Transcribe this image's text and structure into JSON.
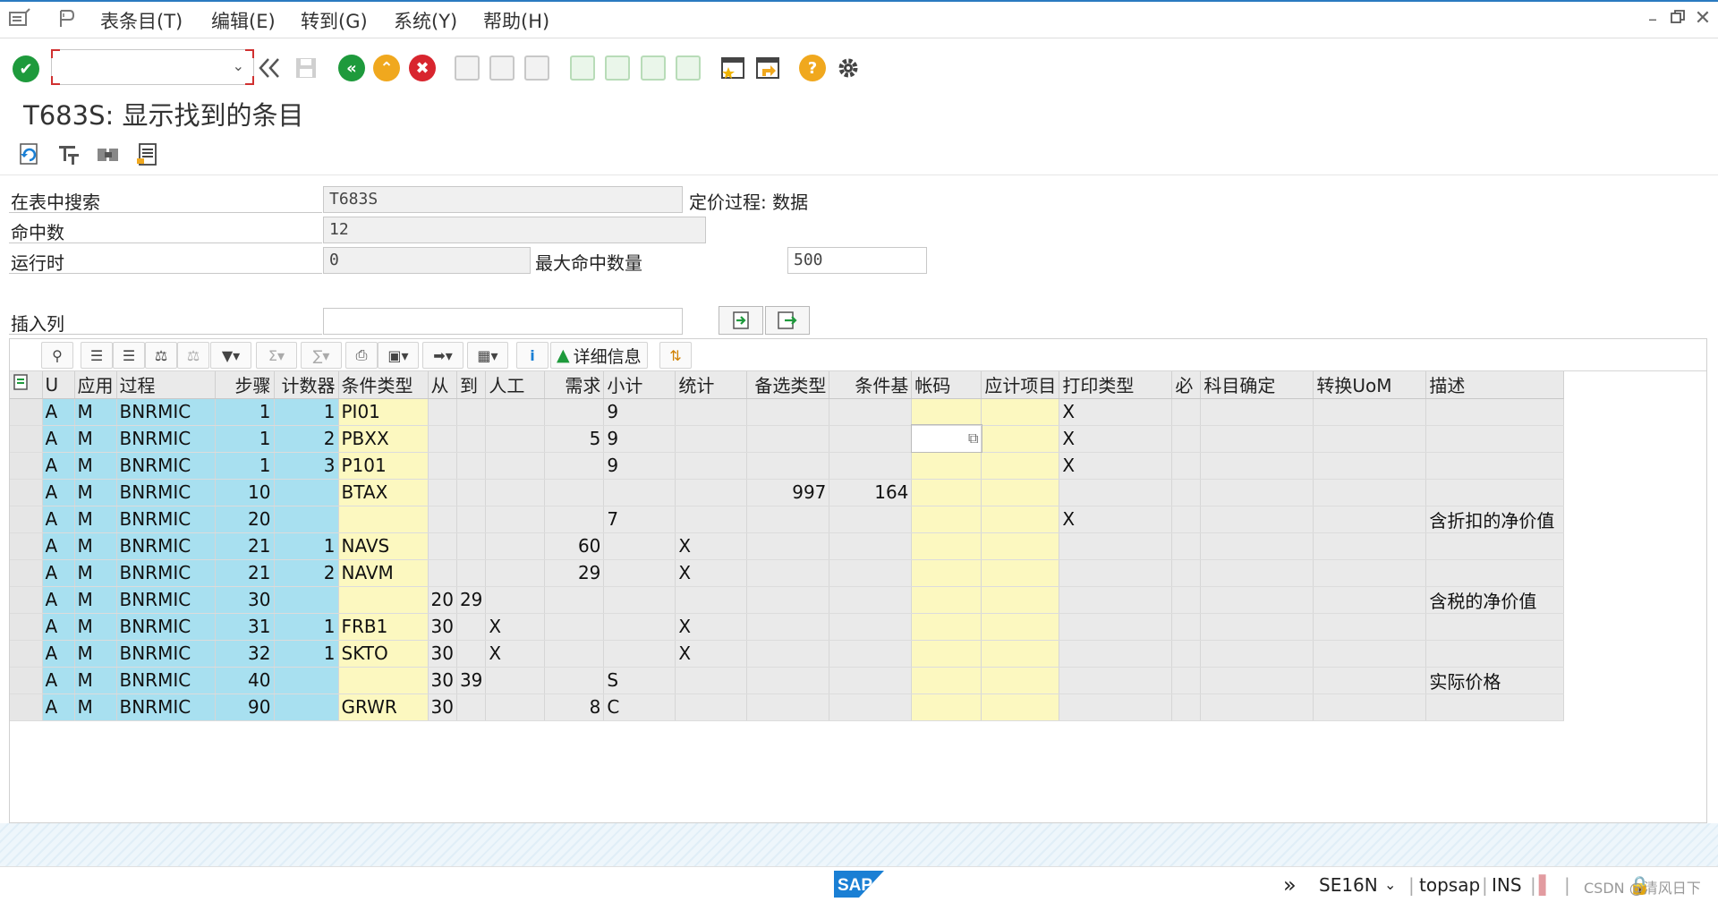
{
  "menubar": {
    "items": [
      "表条目(T)",
      "编辑(E)",
      "转到(G)",
      "系统(Y)",
      "帮助(H)"
    ]
  },
  "title": "T683S: 显示找到的条目",
  "form": {
    "search_label": "在表中搜索",
    "search_value": "T683S",
    "search_desc": "定价过程: 数据",
    "hits_label": "命中数",
    "hits_value": "12",
    "runtime_label": "运行时",
    "runtime_value": "0",
    "maxhits_label": "最大命中数量",
    "maxhits_value": "500",
    "insert_col_label": "插入列",
    "insert_col_value": ""
  },
  "grid_toolbar": {
    "details_label": "详细信息"
  },
  "grid": {
    "columns": [
      "U",
      "应用",
      "过程",
      "步骤",
      "计数器",
      "条件类型",
      "从",
      "到",
      "人工",
      "需求",
      "小计",
      "统计",
      "备选类型",
      "条件基",
      "帐码",
      "应计项目",
      "打印类型",
      "必",
      "科目确定",
      "转换UoM",
      "描述"
    ],
    "rows": [
      [
        "A",
        "M",
        "BNRMIC",
        "1",
        "1",
        "PI01",
        "",
        "",
        "",
        "",
        "9",
        "",
        "",
        "",
        "",
        "",
        "X",
        "",
        "",
        "",
        ""
      ],
      [
        "A",
        "M",
        "BNRMIC",
        "1",
        "2",
        "PBXX",
        "",
        "",
        "",
        "5",
        "9",
        "",
        "",
        "",
        "",
        "",
        "X",
        "",
        "",
        "",
        ""
      ],
      [
        "A",
        "M",
        "BNRMIC",
        "1",
        "3",
        "P101",
        "",
        "",
        "",
        "",
        "9",
        "",
        "",
        "",
        "",
        "",
        "X",
        "",
        "",
        "",
        ""
      ],
      [
        "A",
        "M",
        "BNRMIC",
        "10",
        "",
        "BTAX",
        "",
        "",
        "",
        "",
        "",
        "",
        "997",
        "164",
        "",
        "",
        "",
        "",
        "",
        "",
        ""
      ],
      [
        "A",
        "M",
        "BNRMIC",
        "20",
        "",
        "",
        "",
        "",
        "",
        "",
        "7",
        "",
        "",
        "",
        "",
        "",
        "X",
        "",
        "",
        "",
        "含折扣的净价值"
      ],
      [
        "A",
        "M",
        "BNRMIC",
        "21",
        "1",
        "NAVS",
        "",
        "",
        "",
        "60",
        "",
        "X",
        "",
        "",
        "",
        "",
        "",
        "",
        "",
        "",
        ""
      ],
      [
        "A",
        "M",
        "BNRMIC",
        "21",
        "2",
        "NAVM",
        "",
        "",
        "",
        "29",
        "",
        "X",
        "",
        "",
        "",
        "",
        "",
        "",
        "",
        "",
        ""
      ],
      [
        "A",
        "M",
        "BNRMIC",
        "30",
        "",
        "",
        "20",
        "29",
        "",
        "",
        "",
        "",
        "",
        "",
        "",
        "",
        "",
        "",
        "",
        "",
        "含税的净价值"
      ],
      [
        "A",
        "M",
        "BNRMIC",
        "31",
        "1",
        "FRB1",
        "30",
        "",
        "X",
        "",
        "",
        "X",
        "",
        "",
        "",
        "",
        "",
        "",
        "",
        "",
        ""
      ],
      [
        "A",
        "M",
        "BNRMIC",
        "32",
        "1",
        "SKTO",
        "30",
        "",
        "X",
        "",
        "",
        "X",
        "",
        "",
        "",
        "",
        "",
        "",
        "",
        "",
        ""
      ],
      [
        "A",
        "M",
        "BNRMIC",
        "40",
        "",
        "",
        "30",
        "39",
        "",
        "",
        "S",
        "",
        "",
        "",
        "",
        "",
        "",
        "",
        "",
        "",
        "实际价格"
      ],
      [
        "A",
        "M",
        "BNRMIC",
        "90",
        "",
        "GRWR",
        "30",
        "",
        "",
        "8",
        "C",
        "",
        "",
        "",
        "",
        "",
        "",
        "",
        "",
        "",
        ""
      ]
    ]
  },
  "statusbar": {
    "logo": "SAP",
    "transaction": "SE16N",
    "server": "topsap",
    "mode": "INS",
    "watermark": "CSDN @清风日下"
  },
  "icons": {
    "menu": "menu-icon",
    "enter": "enter-checkmark-icon",
    "back": "back-icon",
    "exit": "exit-icon",
    "cancel": "cancel-icon",
    "help": "help-icon",
    "settings": "gear-icon"
  },
  "colors": {
    "key_column": "#a8e0f0",
    "input_column": "#fcf8c0",
    "enter_green": "#1e9a3c",
    "back_green": "#1e9a3c",
    "exit_orange": "#f0a81e",
    "cancel_red": "#d8252e",
    "help_orange": "#f0a81e",
    "sap_blue": "#1a7fd4"
  }
}
